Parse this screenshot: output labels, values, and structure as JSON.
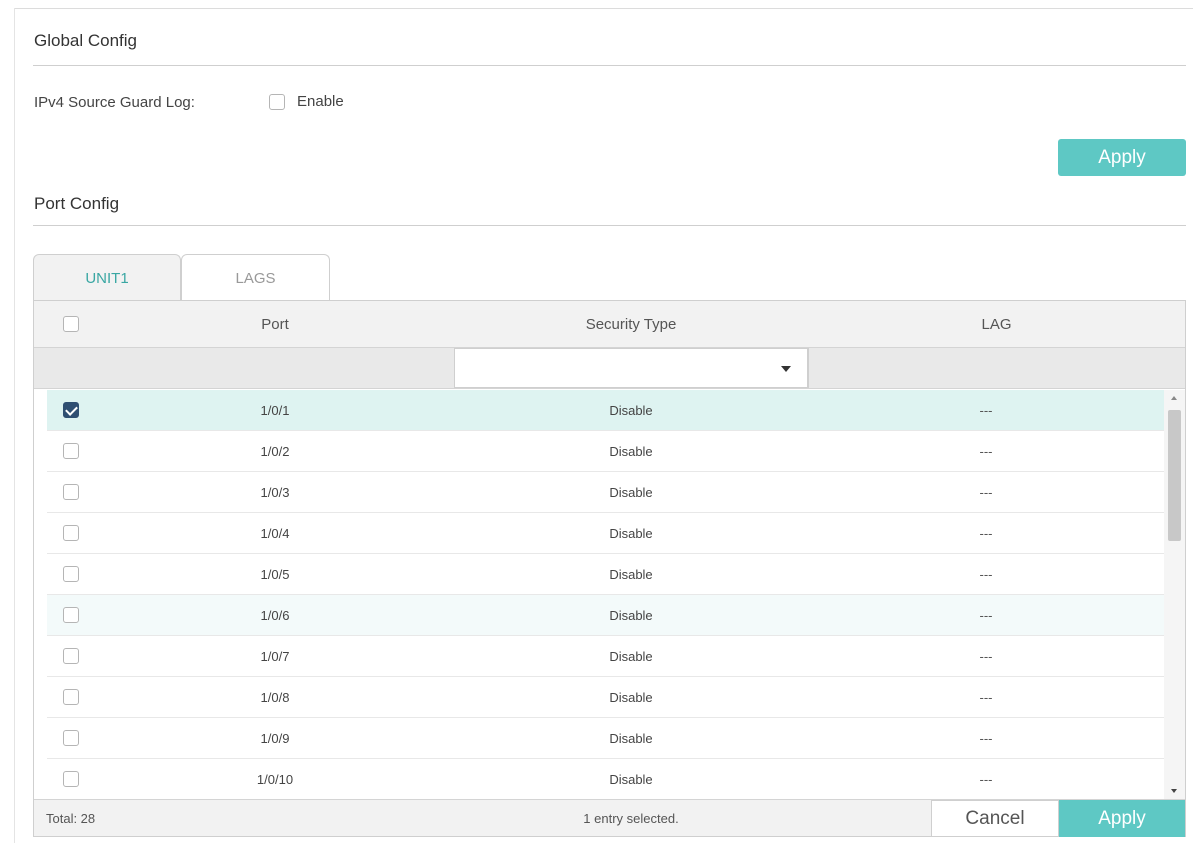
{
  "global_config": {
    "title": "Global Config",
    "log_label": "IPv4 Source Guard Log:",
    "enable_label": "Enable",
    "enable_checked": false,
    "apply_label": "Apply"
  },
  "port_config": {
    "title": "Port Config",
    "tabs": [
      {
        "label": "UNIT1",
        "active": true
      },
      {
        "label": "LAGS",
        "active": false
      }
    ],
    "columns": {
      "port": "Port",
      "security_type": "Security Type",
      "lag": "LAG"
    },
    "filter": {
      "security_type_value": ""
    },
    "rows": [
      {
        "port": "1/0/1",
        "security_type": "Disable",
        "lag": "---",
        "checked": true
      },
      {
        "port": "1/0/2",
        "security_type": "Disable",
        "lag": "---",
        "checked": false
      },
      {
        "port": "1/0/3",
        "security_type": "Disable",
        "lag": "---",
        "checked": false
      },
      {
        "port": "1/0/4",
        "security_type": "Disable",
        "lag": "---",
        "checked": false
      },
      {
        "port": "1/0/5",
        "security_type": "Disable",
        "lag": "---",
        "checked": false
      },
      {
        "port": "1/0/6",
        "security_type": "Disable",
        "lag": "---",
        "checked": false
      },
      {
        "port": "1/0/7",
        "security_type": "Disable",
        "lag": "---",
        "checked": false
      },
      {
        "port": "1/0/8",
        "security_type": "Disable",
        "lag": "---",
        "checked": false
      },
      {
        "port": "1/0/9",
        "security_type": "Disable",
        "lag": "---",
        "checked": false
      },
      {
        "port": "1/0/10",
        "security_type": "Disable",
        "lag": "---",
        "checked": false
      }
    ],
    "footer": {
      "total": "Total: 28",
      "selected_info": "1 entry selected.",
      "cancel_label": "Cancel",
      "apply_label": "Apply"
    }
  },
  "colors": {
    "accent": "#5ec8c4",
    "selected_row": "#def3f1",
    "checkbox_checked": "#2f4f72"
  }
}
